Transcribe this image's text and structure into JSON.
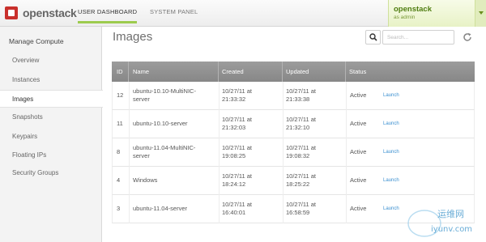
{
  "brand": {
    "logo_text": "openstack",
    "accent": "#c9302c"
  },
  "nav": {
    "tabs": [
      {
        "label": "USER DASHBOARD"
      },
      {
        "label": "SYSTEM PANEL"
      }
    ]
  },
  "project": {
    "name": "openstack",
    "user": "as admin"
  },
  "sidebar": {
    "title": "Manage Compute",
    "items": [
      {
        "label": "Overview"
      },
      {
        "label": "Instances"
      },
      {
        "label": "Images"
      },
      {
        "label": "Snapshots"
      },
      {
        "label": "Keypairs"
      },
      {
        "label": "Floating IPs"
      },
      {
        "label": "Security Groups"
      }
    ]
  },
  "main": {
    "title": "Images",
    "search": {
      "placeholder": "Search..."
    },
    "table": {
      "headers": [
        "ID",
        "Name",
        "Created",
        "Updated",
        "Status"
      ],
      "rows": [
        {
          "id": "12",
          "name_1": "ubuntu-10.10-MultiNIC-",
          "name_2": "server",
          "created_1": "10/27/11 at",
          "created_2": "21:33:32",
          "updated_1": "10/27/11 at",
          "updated_2": "21:33:38",
          "status": "Active",
          "action": "Launch"
        },
        {
          "id": "11",
          "name_1": "ubuntu-10.10-server",
          "name_2": "",
          "created_1": "10/27/11 at",
          "created_2": "21:32:03",
          "updated_1": "10/27/11 at",
          "updated_2": "21:32:10",
          "status": "Active",
          "action": "Launch"
        },
        {
          "id": "8",
          "name_1": "ubuntu-11.04-MultiNIC-",
          "name_2": "server",
          "created_1": "10/27/11 at",
          "created_2": "19:08:25",
          "updated_1": "10/27/11 at",
          "updated_2": "19:08:32",
          "status": "Active",
          "action": "Launch"
        },
        {
          "id": "4",
          "name_1": "Windows",
          "name_2": "",
          "created_1": "10/27/11 at",
          "created_2": "18:24:12",
          "updated_1": "10/27/11 at",
          "updated_2": "18:25:22",
          "status": "Active",
          "action": "Launch"
        },
        {
          "id": "3",
          "name_1": "ubuntu-11.04-server",
          "name_2": "",
          "created_1": "10/27/11 at",
          "created_2": "16:40:01",
          "updated_1": "10/27/11 at",
          "updated_2": "16:58:59",
          "status": "Active",
          "action": "Launch"
        }
      ]
    }
  },
  "watermark": {
    "text_cn": "运维网",
    "text_en": "iyunv.com"
  }
}
